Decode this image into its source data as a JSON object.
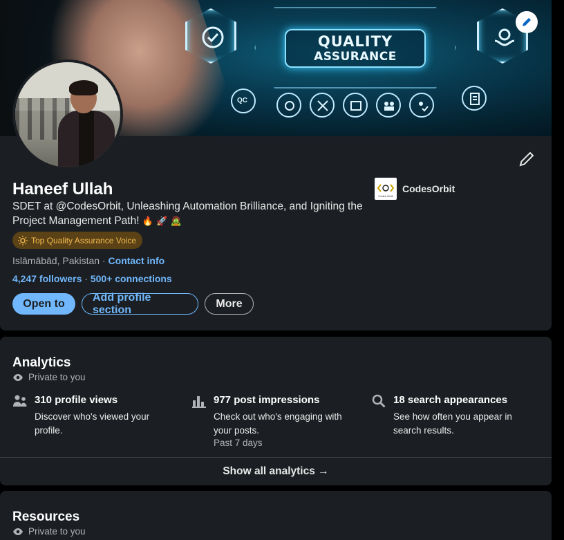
{
  "banner": {
    "title_line1": "QUALITY",
    "title_line2": "ASSURANCE",
    "badge_text": "QC"
  },
  "profile": {
    "name": "Haneef Ullah",
    "headline": "SDET at @CodesOrbit, Unleashing Automation Brilliance, and Igniting the Project Management Path! ",
    "headline_emojis": [
      "🔥",
      "🚀",
      "🧟"
    ],
    "voice_badge": "Top Quality Assurance Voice",
    "location": "Islāmābād, Pakistan",
    "location_separator": " · ",
    "contact_info": "Contact info",
    "followers": "4,247 followers",
    "connections_separator": " · ",
    "connections": "500+ connections",
    "buttons": {
      "open_to": "Open to",
      "add_section": "Add profile section",
      "more": "More"
    },
    "company": {
      "name": "CodesOrbit",
      "logo_text": "Codes Orbit"
    }
  },
  "analytics": {
    "title": "Analytics",
    "private_label": "Private to you",
    "metrics": [
      {
        "title": "310 profile views",
        "desc": "Discover who's viewed your profile.",
        "sub": "",
        "icon": "people-icon"
      },
      {
        "title": "977 post impressions",
        "desc": "Check out who's engaging with your posts.",
        "sub": "Past 7 days",
        "icon": "bar-chart-icon"
      },
      {
        "title": "18 search appearances",
        "desc": "See how often you appear in search results.",
        "sub": "",
        "icon": "search-icon"
      }
    ],
    "show_all": "Show all analytics →"
  },
  "resources": {
    "title": "Resources",
    "private_label": "Private to you"
  },
  "colors": {
    "card_bg": "#1b1f23",
    "page_bg": "#000000",
    "link": "#71b7fb",
    "muted": "#b0b4b8",
    "badge_bg": "#5a4216",
    "badge_text": "#f4b94e"
  }
}
